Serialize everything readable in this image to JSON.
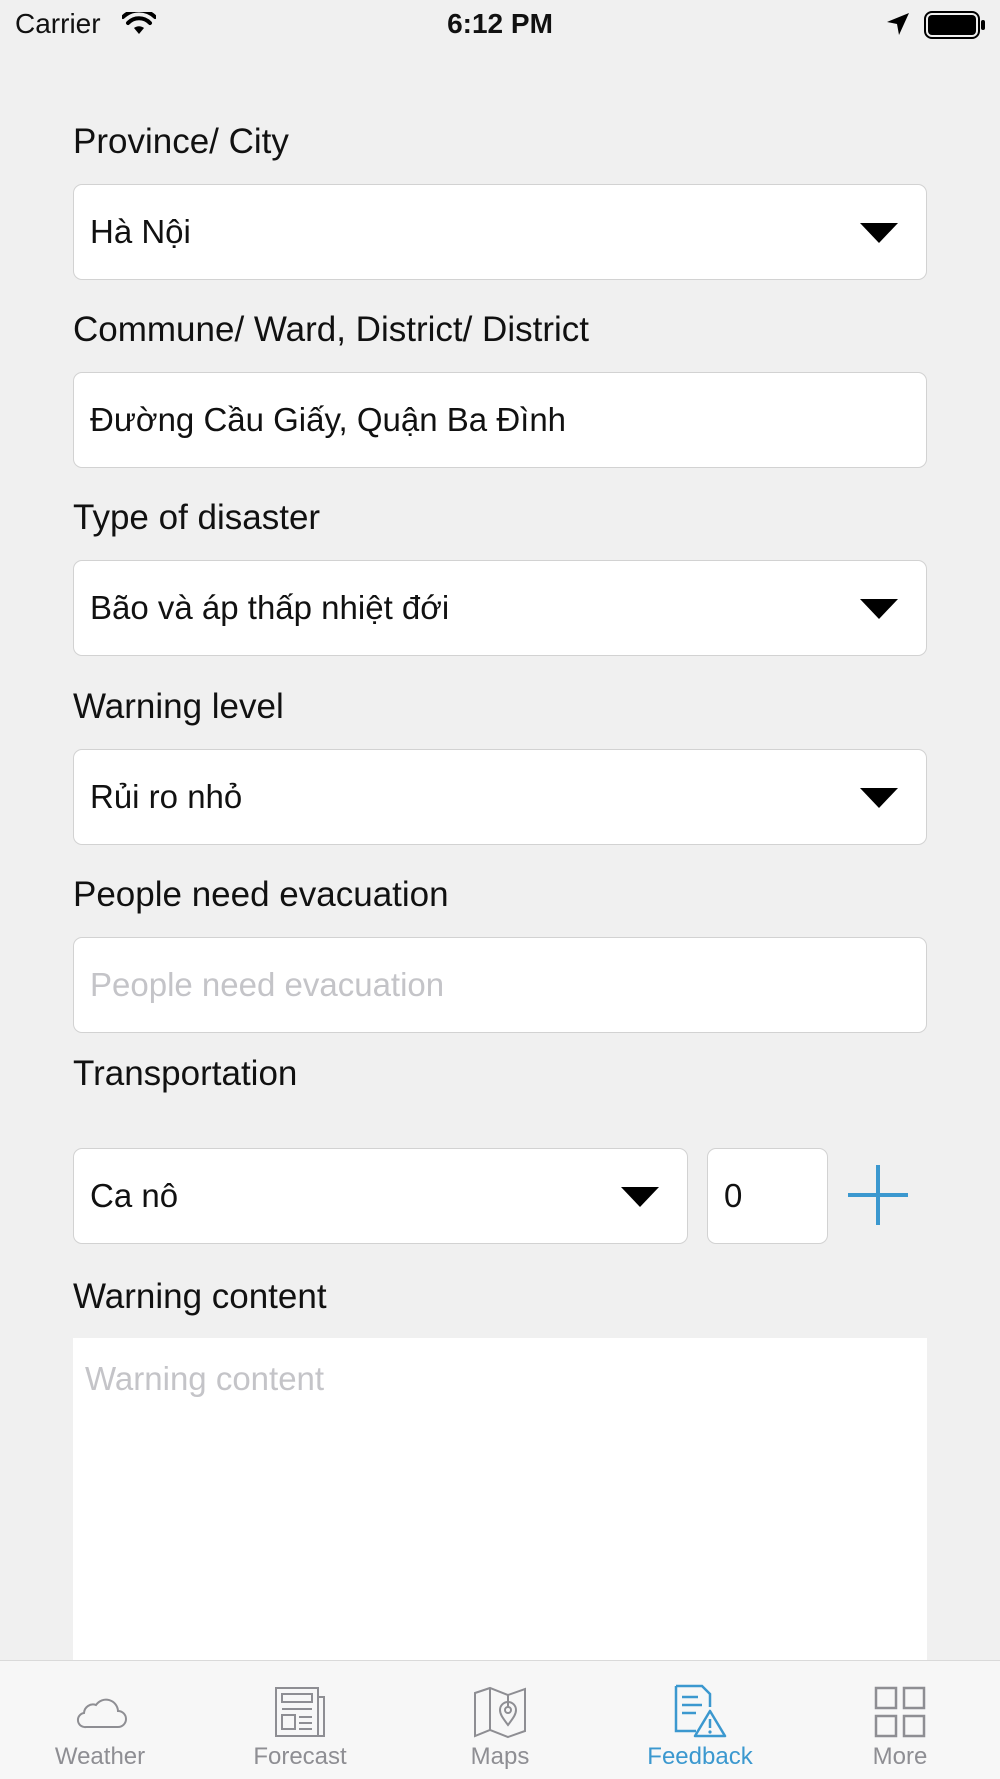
{
  "status_bar": {
    "carrier": "Carrier",
    "time": "6:12 PM"
  },
  "form": {
    "province": {
      "label": "Province/ City",
      "value": "Hà Nội"
    },
    "commune": {
      "label": "Commune/ Ward, District/ District",
      "value": "Đường Cầu Giấy, Quận Ba Đình"
    },
    "disaster_type": {
      "label": "Type of disaster",
      "value": "Bão và áp thấp nhiệt đới"
    },
    "warning_level": {
      "label": "Warning level",
      "value": "Rủi ro nhỏ"
    },
    "evacuation": {
      "label": "People need evacuation",
      "placeholder": "People need evacuation"
    },
    "transportation": {
      "label": "Transportation",
      "value": "Ca nô",
      "quantity": "0"
    },
    "warning_content": {
      "label": "Warning content",
      "placeholder": "Warning content"
    }
  },
  "tabbar": {
    "active": "Feedback",
    "accent_color": "#3b98cf",
    "tabs": [
      {
        "label": "Weather",
        "icon": "cloud-icon"
      },
      {
        "label": "Forecast",
        "icon": "newspaper-icon"
      },
      {
        "label": "Maps",
        "icon": "map-icon"
      },
      {
        "label": "Feedback",
        "icon": "feedback-warning-icon"
      },
      {
        "label": "More",
        "icon": "grid-icon"
      }
    ]
  }
}
